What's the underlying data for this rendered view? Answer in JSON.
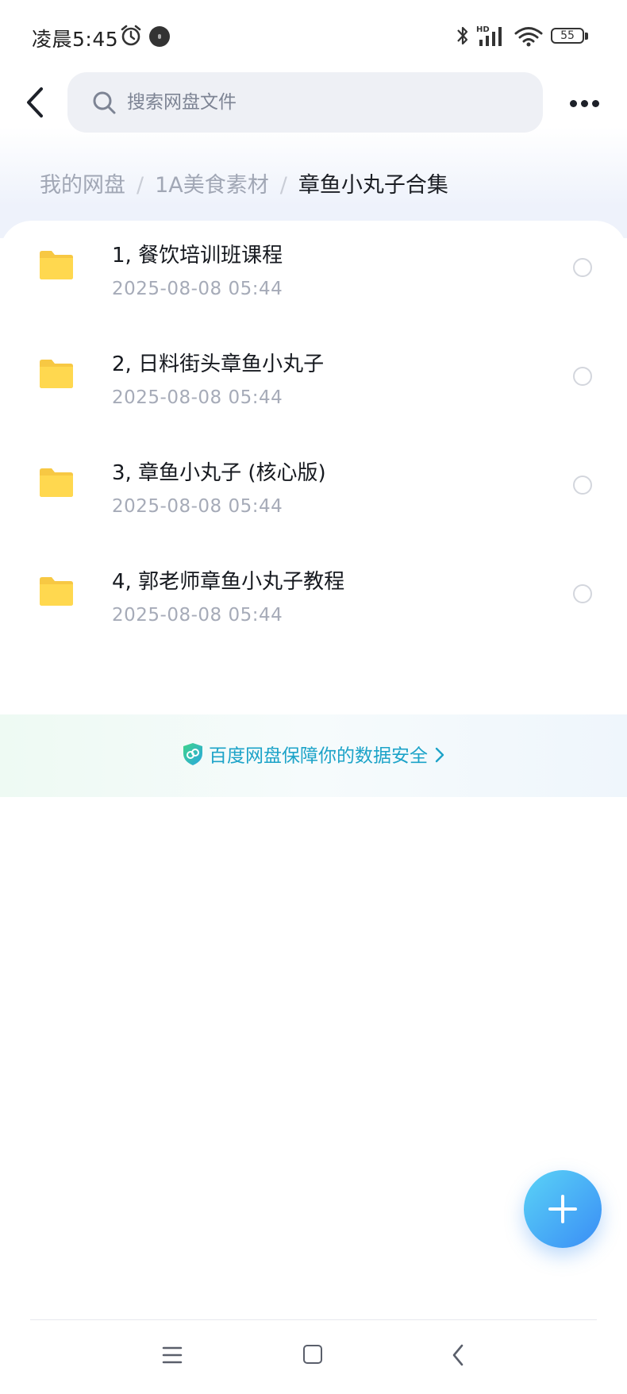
{
  "status_bar": {
    "time": "凌晨5:45",
    "battery": "55"
  },
  "search": {
    "placeholder": "搜索网盘文件"
  },
  "breadcrumb": {
    "items": [
      "我的网盘",
      "1A美食素材"
    ],
    "separator": "/",
    "current": "章鱼小丸子合集"
  },
  "files": [
    {
      "name": "1, 餐饮培训班课程",
      "date": "2025-08-08  05:44",
      "icon": "folder-icon"
    },
    {
      "name": "2, 日料街头章鱼小丸子",
      "date": "2025-08-08  05:44",
      "icon": "folder-icon"
    },
    {
      "name": "3, 章鱼小丸子 (核心版)",
      "date": "2025-08-08  05:44",
      "icon": "folder-icon"
    },
    {
      "name": "4, 郭老师章鱼小丸子教程",
      "date": "2025-08-08  05:44",
      "icon": "folder-icon"
    }
  ],
  "security_banner": {
    "text": "百度网盘保障你的数据安全",
    "icon": "shield-icon"
  },
  "colors": {
    "accent": "#1ca3c8",
    "folder": "#ffd54f",
    "fab_start": "#5ad3f7",
    "fab_end": "#3a8df5"
  }
}
